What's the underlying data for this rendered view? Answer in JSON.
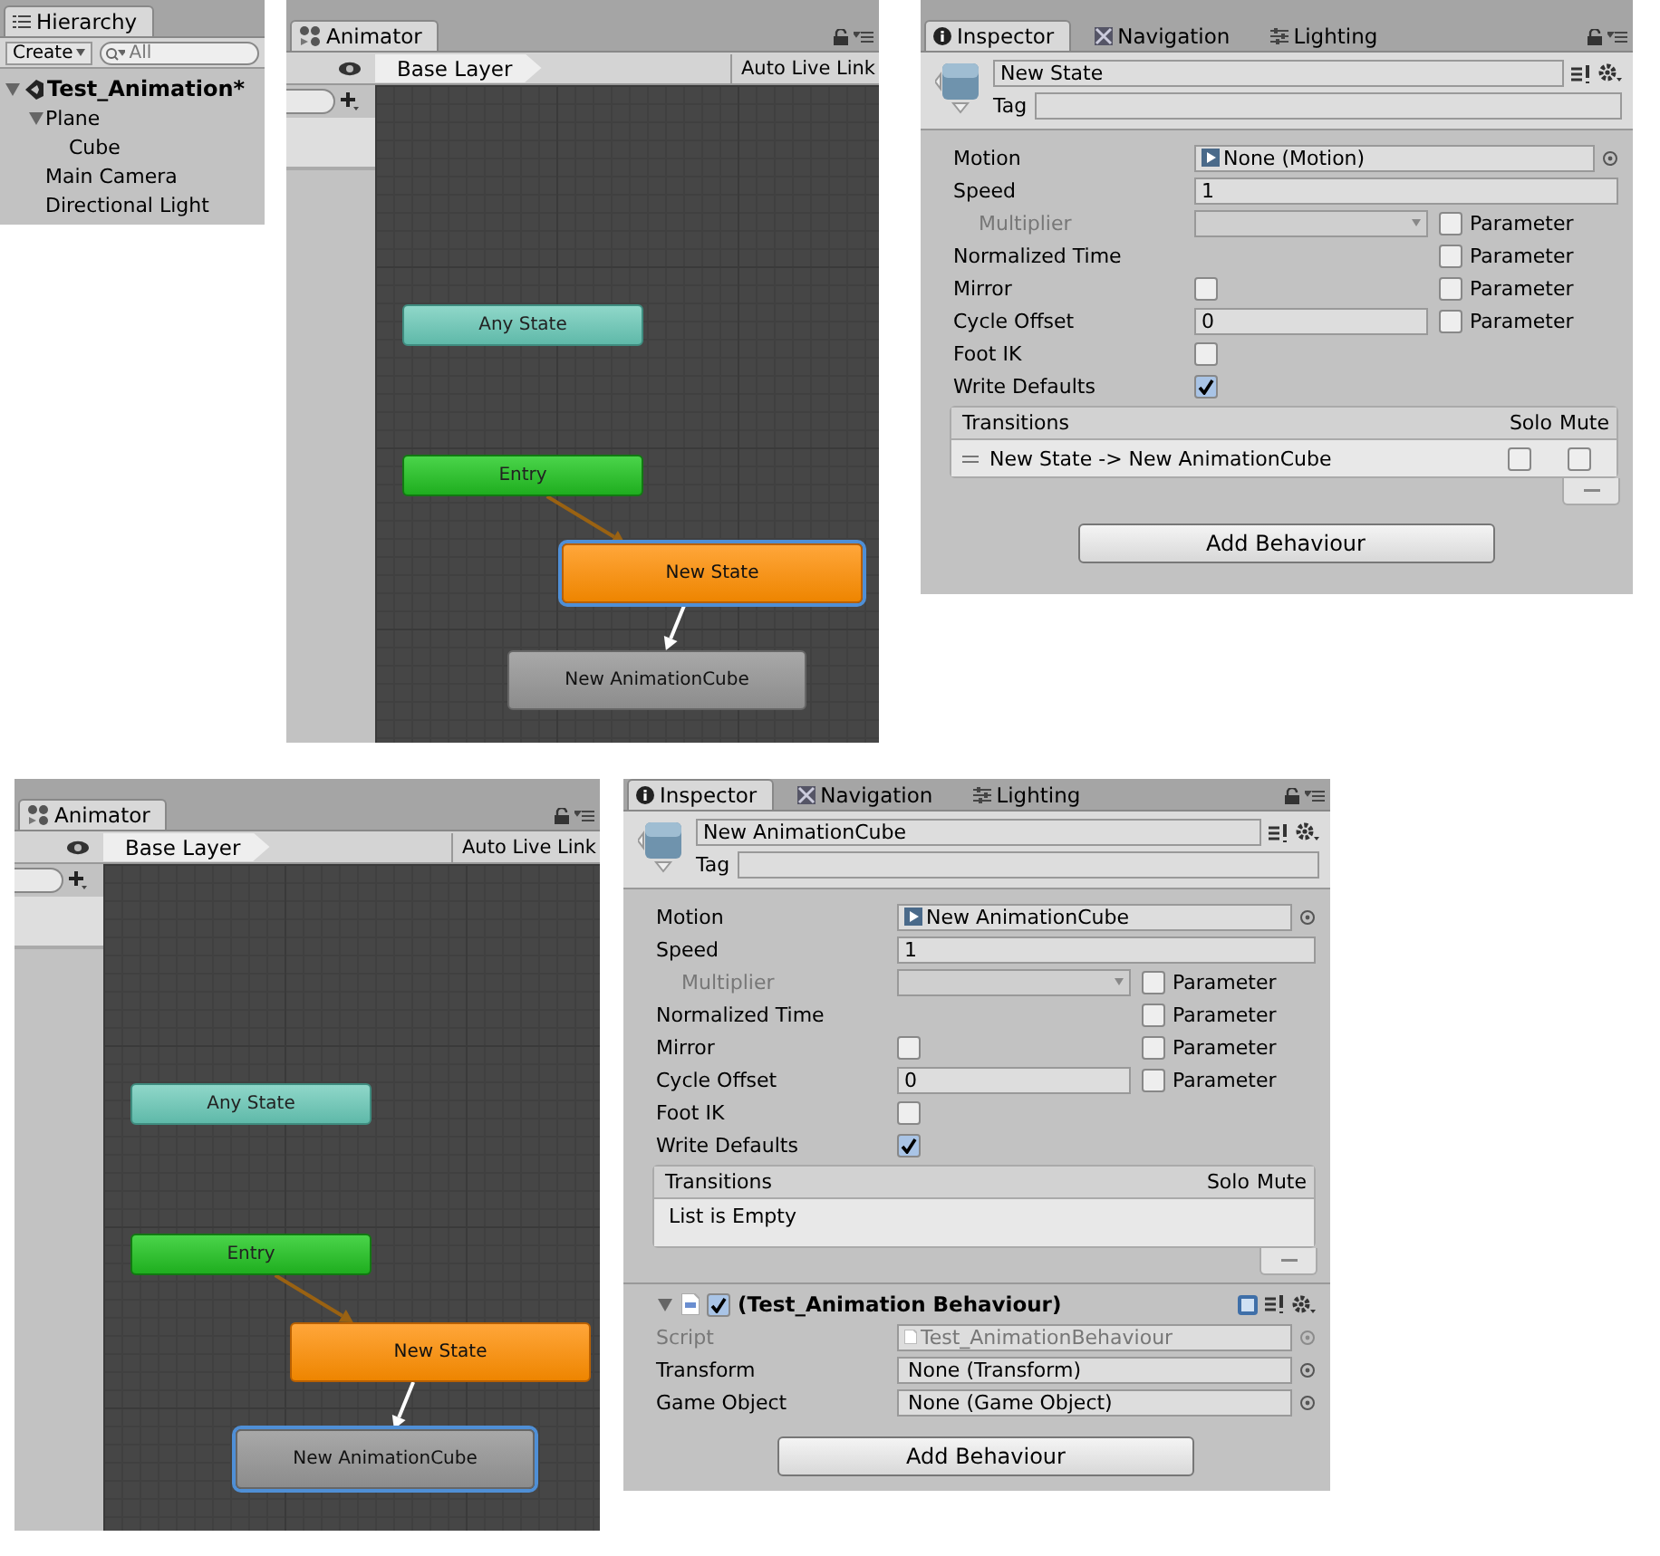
{
  "hierarchy": {
    "tab": "Hierarchy",
    "create_button": "Create",
    "search": {
      "placeholder": "All"
    },
    "tree": [
      {
        "label": "Test_Animation*",
        "kind": "scene",
        "expanded": true,
        "children": [
          {
            "label": "Plane",
            "expanded": true,
            "children": [
              {
                "label": "Cube"
              }
            ]
          },
          {
            "label": "Main Camera"
          },
          {
            "label": "Directional Light"
          }
        ]
      }
    ]
  },
  "animators": [
    {
      "tab": "Animator",
      "breadcrumb": "Base Layer",
      "live_link": "Auto Live Link",
      "nodes": [
        {
          "label": "Any State",
          "kind": "any",
          "default": false,
          "selected": false,
          "arrow_to_next": false
        },
        {
          "label": "Entry",
          "kind": "entry",
          "default": false,
          "selected": false,
          "arrow_to_next": true
        },
        {
          "label": "New State",
          "kind": "state",
          "default": true,
          "selected": true,
          "arrow_to_next": true
        },
        {
          "label": "New AnimationCube",
          "kind": "state",
          "default": false,
          "selected": false,
          "arrow_to_next": false
        }
      ]
    },
    {
      "tab": "Animator",
      "breadcrumb": "Base Layer",
      "live_link": "Auto Live Link",
      "nodes": [
        {
          "label": "Any State",
          "kind": "any",
          "default": false,
          "selected": false,
          "arrow_to_next": false
        },
        {
          "label": "Entry",
          "kind": "entry",
          "default": false,
          "selected": false,
          "arrow_to_next": true
        },
        {
          "label": "New State",
          "kind": "state",
          "default": true,
          "selected": false,
          "arrow_to_next": true
        },
        {
          "label": "New AnimationCube",
          "kind": "state",
          "default": false,
          "selected": true,
          "arrow_to_next": false
        }
      ]
    }
  ],
  "inspectors": [
    {
      "tabs": [
        {
          "label": "Inspector",
          "kind": "info",
          "selected": true
        },
        {
          "label": "Navigation",
          "kind": "nav",
          "selected": false
        },
        {
          "label": "Lighting",
          "kind": "light",
          "selected": false
        }
      ],
      "name": "New State",
      "tag_label": "Tag",
      "properties": [
        {
          "label": "Motion",
          "kind": "object",
          "value": "None (Motion)"
        },
        {
          "label": "Speed",
          "kind": "text",
          "value": "1",
          "children": [
            {
              "label": "Multiplier",
              "kind": "dropdown",
              "disabled": true,
              "parameter": {
                "label": "Parameter",
                "checked": false
              }
            }
          ]
        },
        {
          "label": "Normalized Time",
          "kind": "none",
          "parameter": {
            "label": "Parameter",
            "checked": false
          }
        },
        {
          "label": "Mirror",
          "kind": "checkbox",
          "checked": false,
          "parameter": {
            "label": "Parameter",
            "checked": false
          }
        },
        {
          "label": "Cycle Offset",
          "kind": "text",
          "value": "0",
          "parameter": {
            "label": "Parameter",
            "checked": false
          }
        },
        {
          "label": "Foot IK",
          "kind": "checkbox",
          "checked": false
        },
        {
          "label": "Write Defaults",
          "kind": "checkbox",
          "checked": true
        }
      ],
      "transitions": {
        "title": "Transitions",
        "solo": "Solo",
        "mute": "Mute",
        "rows": [
          {
            "label": "New State -> New AnimationCube",
            "solo": false,
            "mute": false
          }
        ]
      },
      "add_button": "Add Behaviour"
    },
    {
      "tabs": [
        {
          "label": "Inspector",
          "kind": "info",
          "selected": true
        },
        {
          "label": "Navigation",
          "kind": "nav",
          "selected": false
        },
        {
          "label": "Lighting",
          "kind": "light",
          "selected": false
        }
      ],
      "name": "New AnimationCube",
      "tag_label": "Tag",
      "properties": [
        {
          "label": "Motion",
          "kind": "object",
          "value": "New AnimationCube"
        },
        {
          "label": "Speed",
          "kind": "text",
          "value": "1",
          "children": [
            {
              "label": "Multiplier",
              "kind": "dropdown",
              "disabled": true,
              "parameter": {
                "label": "Parameter",
                "checked": false
              }
            }
          ]
        },
        {
          "label": "Normalized Time",
          "kind": "none",
          "parameter": {
            "label": "Parameter",
            "checked": false
          }
        },
        {
          "label": "Mirror",
          "kind": "checkbox",
          "checked": false,
          "parameter": {
            "label": "Parameter",
            "checked": false
          }
        },
        {
          "label": "Cycle Offset",
          "kind": "text",
          "value": "0",
          "parameter": {
            "label": "Parameter",
            "checked": false
          }
        },
        {
          "label": "Foot IK",
          "kind": "checkbox",
          "checked": false
        },
        {
          "label": "Write Defaults",
          "kind": "checkbox",
          "checked": true
        }
      ],
      "transitions": {
        "title": "Transitions",
        "solo": "Solo",
        "mute": "Mute",
        "empty_text": "List is Empty"
      },
      "behaviour": {
        "title": "(Test_Animation Behaviour)",
        "expanded": true,
        "enabled": true,
        "fields": [
          {
            "label": "Script",
            "value": "Test_AnimationBehaviour",
            "disabled": true
          },
          {
            "label": "Transform",
            "value": "None (Transform)",
            "disabled": false
          },
          {
            "label": "Game Object",
            "value": "None (Game Object)",
            "disabled": false
          }
        ]
      },
      "add_button": "Add Behaviour"
    }
  ]
}
